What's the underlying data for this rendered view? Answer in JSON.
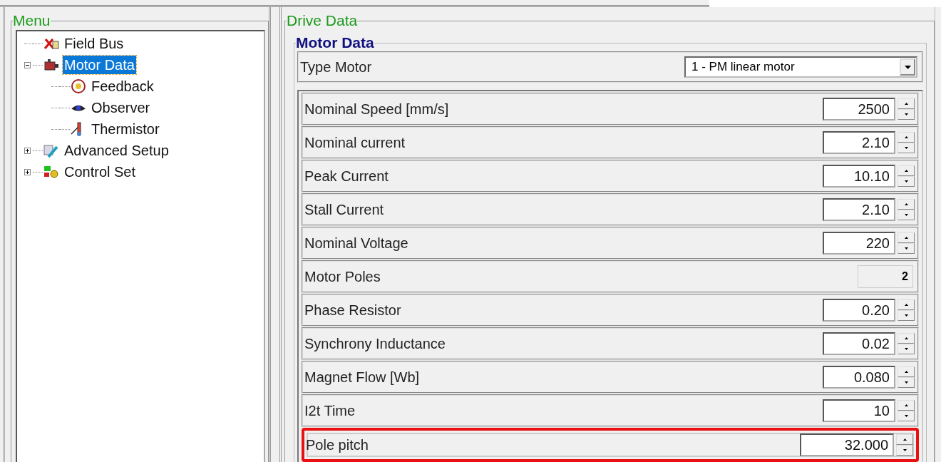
{
  "menu": {
    "title": "Menu",
    "tree": [
      {
        "label": "Field Bus",
        "selected": false
      },
      {
        "label": "Motor Data",
        "selected": true,
        "expanded": true,
        "children": [
          {
            "label": "Feedback",
            "selected": false
          },
          {
            "label": "Observer",
            "selected": false
          },
          {
            "label": "Thermistor",
            "selected": false
          }
        ]
      },
      {
        "label": "Advanced Setup",
        "selected": false,
        "expanded": false
      },
      {
        "label": "Control Set",
        "selected": false,
        "expanded": false
      }
    ]
  },
  "drive_data": {
    "title": "Drive Data",
    "section_title": "Motor Data",
    "type_motor": {
      "label": "Type Motor",
      "value": "1 - PM linear motor"
    },
    "params": [
      {
        "label": "Nominal Speed [mm/s]",
        "value": "2500",
        "kind": "spin",
        "highlighted": false
      },
      {
        "label": "Nominal current",
        "value": "2.10",
        "kind": "spin",
        "highlighted": false
      },
      {
        "label": "Peak Current",
        "value": "10.10",
        "kind": "spin",
        "highlighted": false
      },
      {
        "label": "Stall Current",
        "value": "2.10",
        "kind": "spin",
        "highlighted": false
      },
      {
        "label": "Nominal Voltage",
        "value": "220",
        "kind": "spin",
        "highlighted": false
      },
      {
        "label": "Motor Poles",
        "value": "2",
        "kind": "readonly",
        "highlighted": false
      },
      {
        "label": "Phase Resistor",
        "value": "0.20",
        "kind": "spin",
        "highlighted": false
      },
      {
        "label": "Synchrony Inductance",
        "value": "0.02",
        "kind": "spin",
        "highlighted": false
      },
      {
        "label": "Magnet Flow [Wb]",
        "value": "0.080",
        "kind": "spin",
        "highlighted": false
      },
      {
        "label": "I2t Time",
        "value": "10",
        "kind": "spin",
        "highlighted": false
      },
      {
        "label": "Pole pitch",
        "value": "32.000",
        "kind": "spin",
        "highlighted": true
      }
    ]
  }
}
